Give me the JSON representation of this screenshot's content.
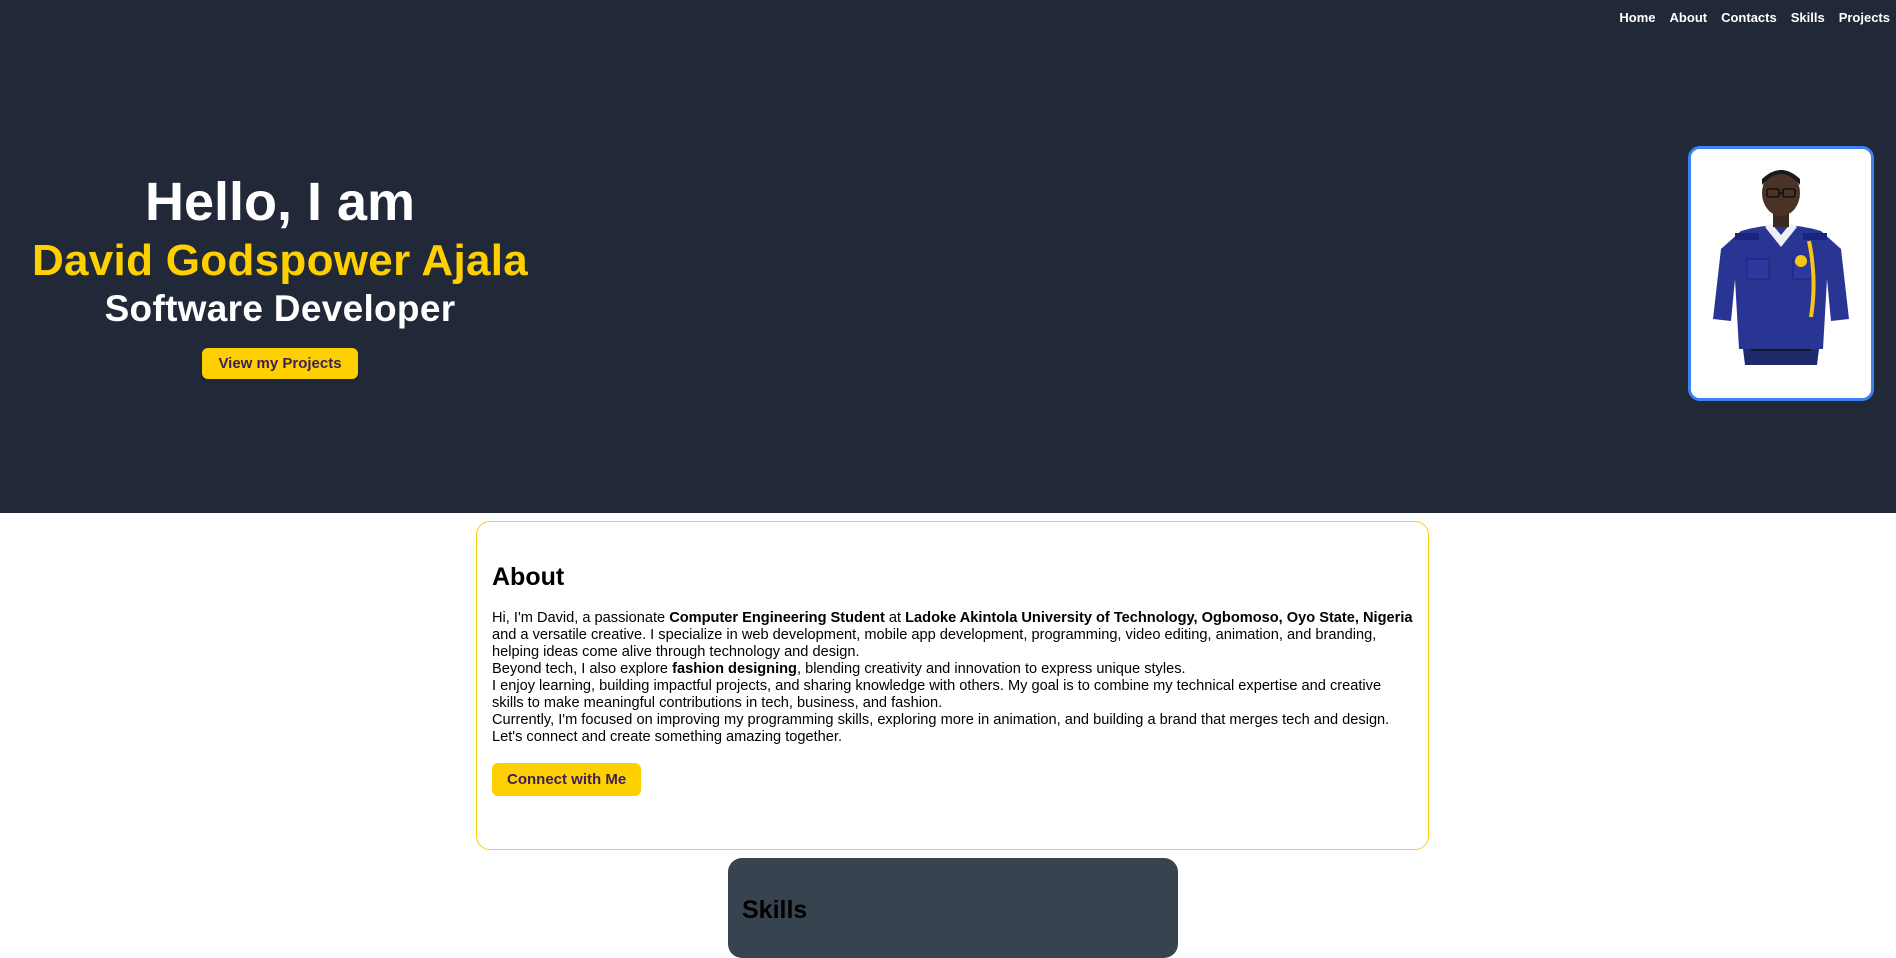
{
  "nav": {
    "items": [
      {
        "label": "Home"
      },
      {
        "label": "About"
      },
      {
        "label": "Contacts"
      },
      {
        "label": "Skills"
      },
      {
        "label": "Projects"
      }
    ]
  },
  "hero": {
    "greeting": "Hello, I am",
    "name": "David Godspower Ajala",
    "role": "Software Developer",
    "button_label": "View my Projects",
    "photo_alt": "Profile photo of David in navy blue uniform"
  },
  "about": {
    "title": "About",
    "p1_a": "Hi, I'm David, a passionate ",
    "p1_b": "Computer Engineering Student",
    "p1_c": " at ",
    "p1_d": "Ladoke Akintola University of Technology, Ogbomoso, Oyo State, Nigeria",
    "p1_e": " and a versatile creative. I specialize in web development, mobile app development, programming, video editing, animation, and branding, helping ideas come alive through technology and design.",
    "p2_a": "Beyond tech, I also explore ",
    "p2_b": "fashion designing",
    "p2_c": ", blending creativity and innovation to express unique styles.",
    "p3": "I enjoy learning, building impactful projects, and sharing knowledge with others. My goal is to combine my technical expertise and creative skills to make meaningful contributions in tech, business, and fashion.",
    "p4": "Currently, I'm focused on improving my programming skills, exploring more in animation, and building a brand that merges tech and design.",
    "p5": "Let's connect and create something amazing together.",
    "button_label": "Connect with Me"
  },
  "skills": {
    "title": "Skills"
  },
  "colors": {
    "hero_bg": "#212938",
    "accent": "#ffd000",
    "photo_border": "#3b82f6",
    "skills_bg": "#37434f"
  }
}
